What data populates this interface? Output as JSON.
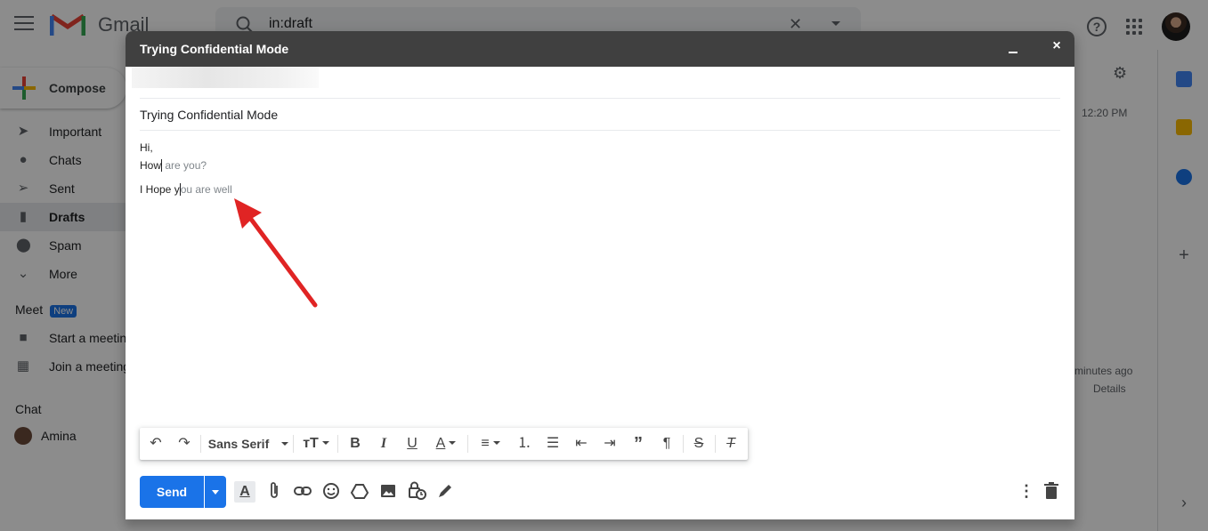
{
  "app": {
    "name": "Gmail",
    "search_value": "in:draft"
  },
  "sidebar": {
    "compose_label": "Compose",
    "items": [
      {
        "label": "Important",
        "icon": "label-important-icon"
      },
      {
        "label": "Chats",
        "icon": "chat-bubble-icon"
      },
      {
        "label": "Sent",
        "icon": "send-icon"
      },
      {
        "label": "Drafts",
        "icon": "draft-icon",
        "active": true
      },
      {
        "label": "Spam",
        "icon": "report-icon"
      },
      {
        "label": "More",
        "icon": "chevron-down-icon"
      }
    ],
    "meet": {
      "title": "Meet",
      "badge": "New",
      "items": [
        {
          "label": "Start a meeting",
          "icon": "videocam-icon"
        },
        {
          "label": "Join a meeting",
          "icon": "keyboard-icon"
        }
      ]
    },
    "chat": {
      "title": "Chat",
      "user": "Amina"
    }
  },
  "main_background": {
    "time": "12:20 PM",
    "activity": "minutes ago",
    "details": "Details"
  },
  "compose": {
    "window_title": "Trying Confidential Mode",
    "subject": "Trying Confidential Mode",
    "body": {
      "line1": "Hi,",
      "line2_typed": "How",
      "line2_suggestion": " are you?",
      "line3_typed": "I Hope y",
      "line3_suggestion": "ou are well"
    },
    "toolbar": {
      "font": "Sans Serif"
    },
    "send_label": "Send"
  },
  "colors": {
    "accent": "#1a73e8",
    "header": "#404040",
    "arrow": "#e02424"
  }
}
